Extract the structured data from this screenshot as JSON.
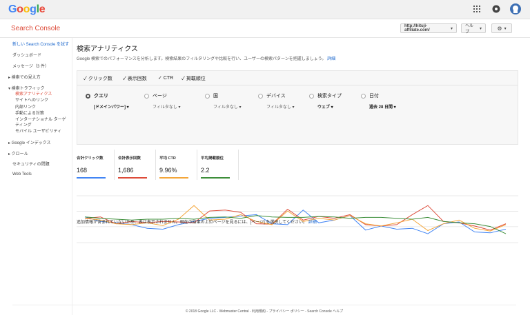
{
  "google_logo": [
    "G",
    "o",
    "o",
    "g",
    "l",
    "e"
  ],
  "google_logo_colors": [
    "#4285F4",
    "#EA4335",
    "#FBBC05",
    "#4285F4",
    "#34A853",
    "#EA4335"
  ],
  "top_icons": [
    "apps-grid-icon",
    "notifications-icon",
    "account-avatar-icon"
  ],
  "brand": "Search Console",
  "site_select": "http://hituji-affiliate.com/",
  "help_button": "ヘルプ",
  "gear_icon": "gear-icon",
  "sidebar": {
    "items": [
      {
        "label": "新しい Search Console を試す",
        "style": "blue"
      },
      {
        "label": "ダッシュボード",
        "style": ""
      },
      {
        "label": "メッセージ（3 件）",
        "style": ""
      },
      {
        "label": "▸ 検索での見え方",
        "style": ""
      },
      {
        "label": "▾ 検索トラフィック",
        "style": ""
      },
      {
        "label": "検索アナリティクス",
        "style": "red"
      },
      {
        "label": "サイトへのリンク",
        "style": ""
      },
      {
        "label": "内部リンク",
        "style": ""
      },
      {
        "label": "手動による対策",
        "style": ""
      },
      {
        "label": "インターナショナル ターゲ",
        "style": ""
      },
      {
        "label": "ティング",
        "style": ""
      },
      {
        "label": "モバイル ユーザビリティ",
        "style": ""
      },
      {
        "label": "▸ Google インデックス",
        "style": ""
      },
      {
        "label": "▸ クロール",
        "style": ""
      },
      {
        "label": "セキュリティの問題",
        "style": ""
      },
      {
        "label": "Web Tools",
        "style": ""
      }
    ]
  },
  "main": {
    "title": "検索アナリティクス",
    "description": "Google 検索でのパフォーマンスを分析します。検索結果のフィルタリングや比較を行い、ユーザーの検索パターンを把握しましょう。",
    "description_link": "詳細",
    "checkboxes": [
      "クリック数",
      "表示回数",
      "CTR",
      "掲載順位"
    ],
    "dimensions": [
      {
        "label": "クエリ",
        "sub": "[ドメインパワー]",
        "selected": true
      },
      {
        "label": "ページ",
        "sub": "フィルタなし",
        "selected": false
      },
      {
        "label": "国",
        "sub": "フィルタなし",
        "selected": false
      },
      {
        "label": "デバイス",
        "sub": "フィルタなし",
        "selected": false
      },
      {
        "label": "検索タイプ",
        "sub": "ウェブ",
        "selected": false
      },
      {
        "label": "日付",
        "sub": "過去 28 日間",
        "selected": false
      }
    ],
    "metrics": [
      {
        "label": "合計クリック数",
        "value": "168",
        "color": "#4285F4"
      },
      {
        "label": "合計表示回数",
        "value": "1,686",
        "color": "#DD4B39"
      },
      {
        "label": "平均 CTR",
        "value": "9.96%",
        "color": "#F4A63A"
      },
      {
        "label": "平均掲載順位",
        "value": "2.2",
        "color": "#3D8E3A"
      }
    ],
    "note": "追加情報が含まれていないため、表は表示されません。現在の結果の上位ページを見るには、[ページ] を選択してください。",
    "note_link": "詳細"
  },
  "chart_data": {
    "type": "line",
    "x": [
      1,
      2,
      3,
      4,
      5,
      6,
      7,
      8,
      9,
      10,
      11,
      12,
      13,
      14,
      15,
      16,
      17,
      18,
      19,
      20,
      21,
      22,
      23,
      24,
      25,
      26,
      27,
      28
    ],
    "series": [
      {
        "values": [
          0.45,
          0.55,
          0.58,
          0.62,
          0.7,
          0.72,
          0.62,
          0.55,
          0.48,
          0.46,
          0.43,
          0.4,
          0.6,
          0.62,
          0.3,
          0.58,
          0.52,
          0.42,
          0.74,
          0.65,
          0.72,
          0.7,
          0.82,
          0.6,
          0.56,
          0.78,
          0.8,
          0.72
        ],
        "color": "#4285F4"
      },
      {
        "values": [
          0.48,
          0.45,
          0.6,
          0.55,
          0.58,
          0.55,
          0.56,
          0.58,
          0.32,
          0.3,
          0.35,
          0.6,
          0.61,
          0.28,
          0.52,
          0.44,
          0.48,
          0.4,
          0.62,
          0.65,
          0.62,
          0.4,
          0.2,
          0.55,
          0.58,
          0.65,
          0.74,
          0.6
        ],
        "color": "#DD4B39"
      },
      {
        "values": [
          0.48,
          0.52,
          0.6,
          0.62,
          0.58,
          0.64,
          0.5,
          0.2,
          0.52,
          0.5,
          0.4,
          0.55,
          0.62,
          0.32,
          0.55,
          0.48,
          0.52,
          0.42,
          0.6,
          0.65,
          0.58,
          0.5,
          0.75,
          0.6,
          0.52,
          0.7,
          0.76,
          0.62
        ],
        "color": "#F4A63A"
      },
      {
        "values": [
          0.45,
          0.48,
          0.5,
          0.52,
          0.5,
          0.5,
          0.48,
          0.5,
          0.46,
          0.45,
          0.48,
          0.42,
          0.45,
          0.46,
          0.46,
          0.44,
          0.45,
          0.48,
          0.46,
          0.46,
          0.48,
          0.5,
          0.46,
          0.55,
          0.58,
          0.6,
          0.66,
          0.82
        ],
        "color": "#3D8E3A"
      }
    ],
    "grid": true
  },
  "footer": "© 2018 Google LLC - Webmaster Central - 利用規約 - プライバシー ポリシー - Search Console ヘルプ"
}
